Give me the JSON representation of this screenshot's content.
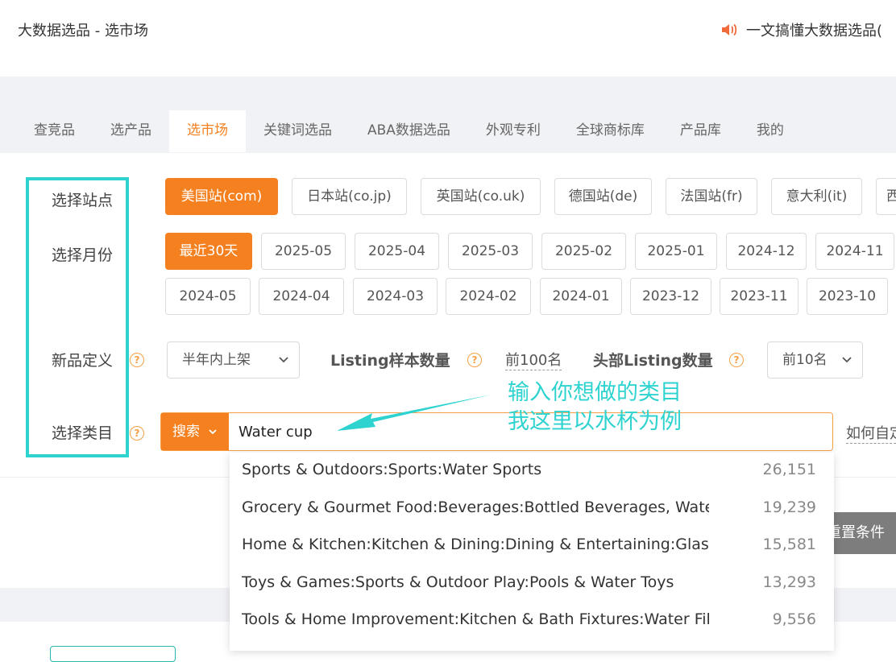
{
  "header": {
    "title": "大数据选品 - 选市场",
    "notice": "一文搞懂大数据选品("
  },
  "tabs": [
    {
      "label": "查竞品"
    },
    {
      "label": "选产品"
    },
    {
      "label": "选市场",
      "active": true
    },
    {
      "label": "关键词选品"
    },
    {
      "label": "ABA数据选品"
    },
    {
      "label": "外观专利"
    },
    {
      "label": "全球商标库"
    },
    {
      "label": "产品库"
    },
    {
      "label": "我的"
    }
  ],
  "labels": {
    "site": "选择站点",
    "month": "选择月份",
    "newdef": "新品定义",
    "category": "选择类目"
  },
  "sites": [
    "美国站(com)",
    "日本站(co.jp)",
    "英国站(co.uk)",
    "德国站(de)",
    "法国站(fr)",
    "意大利(it)",
    "西"
  ],
  "months_row1": [
    "最近30天",
    "2025-05",
    "2025-04",
    "2025-03",
    "2025-02",
    "2025-01",
    "2024-12",
    "2024-11"
  ],
  "months_row2": [
    "2024-05",
    "2024-04",
    "2024-03",
    "2024-02",
    "2024-01",
    "2023-12",
    "2023-11",
    "2023-10"
  ],
  "newdef": {
    "select_value": "半年内上架",
    "listing_label": "Listing样本数量",
    "listing_value": "前100名",
    "head_label": "头部Listing数量",
    "head_value": "前10名"
  },
  "category": {
    "search_button": "搜索",
    "input_value": "Water cup",
    "howto": "如何自定"
  },
  "annotation": {
    "line1": "输入你想做的类目",
    "line2": "我这里以水杯为例"
  },
  "dropdown": [
    {
      "name": "Sports & Outdoors:Sports:Water Sports",
      "count": "26,151"
    },
    {
      "name": "Grocery & Gourmet Food:Beverages:Bottled Beverages, Water …",
      "count": "19,239"
    },
    {
      "name": "Home & Kitchen:Kitchen & Dining:Dining & Entertaining:Glass…",
      "count": "15,581"
    },
    {
      "name": "Toys & Games:Sports & Outdoor Play:Pools & Water Toys",
      "count": "13,293"
    },
    {
      "name": "Tools & Home Improvement:Kitchen & Bath Fixtures:Water Filt…",
      "count": "9,556"
    }
  ],
  "reset_button": "重置条件",
  "colors": {
    "accent": "#f5801f",
    "highlight": "#2ed3d0"
  },
  "icons": [
    "speaker-icon",
    "help-icon",
    "chevron-down-icon"
  ]
}
